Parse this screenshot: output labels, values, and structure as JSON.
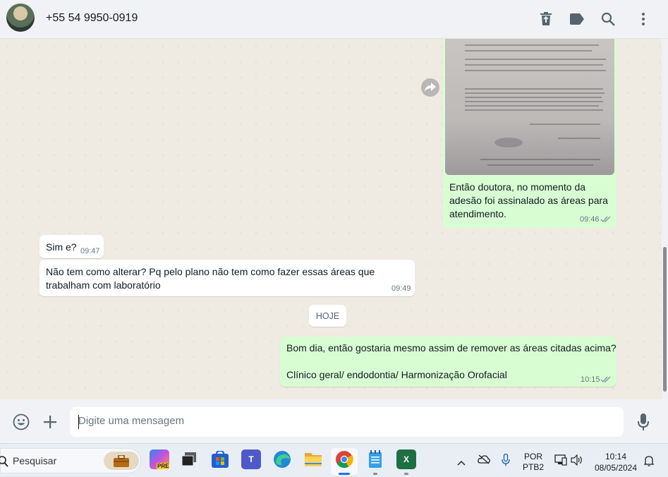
{
  "header": {
    "contact_name": "+55 54 9950-0919",
    "icons": [
      "delete-icon",
      "label-icon",
      "search-icon",
      "menu-icon"
    ]
  },
  "messages": [
    {
      "direction": "out",
      "type": "image-caption",
      "text": "Então doutora, no momento da adesão foi assinalado as áreas para atendimento.",
      "line1": "Então doutora, no momento da",
      "line2": "adesão foi assinalado as áreas para",
      "line3": "atendimento.",
      "time": "09:46",
      "status": "read"
    },
    {
      "direction": "in",
      "text": "Sim e?",
      "time": "09:47"
    },
    {
      "direction": "in",
      "text": "Não tem como alterar? Pq pelo plano não tem como fazer essas áreas que trabalham com laboratório",
      "line1": "Não tem como alterar? Pq pelo plano não tem como fazer essas áreas que",
      "line2": "trabalham com laboratório",
      "time": "09:49"
    },
    {
      "direction": "out",
      "line1": "Bom dia, então gostaria mesmo assim de remover as áreas citadas acima?",
      "line2": "Clínico geral/ endodontia/ Harmonização Orofacial",
      "time": "10:15",
      "status": "read"
    }
  ],
  "date_divider": "HOJE",
  "composer": {
    "placeholder": "Digite uma mensagem",
    "icons": [
      "emoji-icon",
      "plus-icon",
      "mic-icon"
    ]
  },
  "taskbar": {
    "search_placeholder": "Pesquisar",
    "apps": [
      "work-briefcase",
      "copilot-pre",
      "task-view",
      "microsoft-store",
      "teams",
      "edge",
      "file-explorer",
      "chrome",
      "notepad",
      "excel"
    ],
    "copilot_badge": "PRE",
    "teams_letter": "T",
    "excel_letter": "X",
    "language_line1": "POR",
    "language_line2": "PTB2",
    "clock_time": "10:14",
    "clock_date": "08/05/2024"
  },
  "colors": {
    "chat_bg": "#efeae2",
    "outgoing_bubble": "#d9fdd3",
    "incoming_bubble": "#ffffff",
    "read_ticks": "#8696a0"
  }
}
